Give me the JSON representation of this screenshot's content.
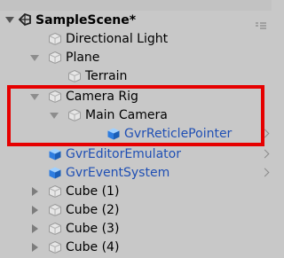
{
  "hierarchy": {
    "scene": {
      "name": "SampleScene*"
    },
    "items": [
      {
        "label": "Directional Light"
      },
      {
        "label": "Plane"
      },
      {
        "label": "Terrain"
      },
      {
        "label": "Camera Rig"
      },
      {
        "label": "Main Camera"
      },
      {
        "label": "GvrReticlePointer"
      },
      {
        "label": "GvrEditorEmulator"
      },
      {
        "label": "GvrEventSystem"
      },
      {
        "label": "Cube (1)"
      },
      {
        "label": "Cube (2)"
      },
      {
        "label": "Cube (3)"
      },
      {
        "label": "Cube (4)"
      }
    ]
  },
  "colors": {
    "background": "#c8c8c8",
    "highlight_border": "#e60000",
    "prefab_text": "#1f4fb4",
    "prefab_icon": "#2e7de0"
  },
  "icons": {
    "scene": "unity-scene-icon",
    "gameobject": "cube-outline-icon",
    "prefab": "prefab-cube-icon",
    "menu": "hamburger-menu-icon"
  }
}
